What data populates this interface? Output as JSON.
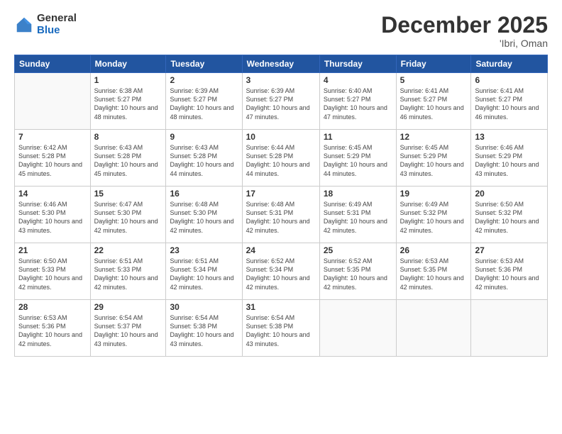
{
  "logo": {
    "general": "General",
    "blue": "Blue"
  },
  "header": {
    "month": "December 2025",
    "location": "'Ibri, Oman"
  },
  "days_of_week": [
    "Sunday",
    "Monday",
    "Tuesday",
    "Wednesday",
    "Thursday",
    "Friday",
    "Saturday"
  ],
  "weeks": [
    [
      {
        "day": "",
        "info": ""
      },
      {
        "day": "1",
        "info": "Sunrise: 6:38 AM\nSunset: 5:27 PM\nDaylight: 10 hours\nand 48 minutes."
      },
      {
        "day": "2",
        "info": "Sunrise: 6:39 AM\nSunset: 5:27 PM\nDaylight: 10 hours\nand 48 minutes."
      },
      {
        "day": "3",
        "info": "Sunrise: 6:39 AM\nSunset: 5:27 PM\nDaylight: 10 hours\nand 47 minutes."
      },
      {
        "day": "4",
        "info": "Sunrise: 6:40 AM\nSunset: 5:27 PM\nDaylight: 10 hours\nand 47 minutes."
      },
      {
        "day": "5",
        "info": "Sunrise: 6:41 AM\nSunset: 5:27 PM\nDaylight: 10 hours\nand 46 minutes."
      },
      {
        "day": "6",
        "info": "Sunrise: 6:41 AM\nSunset: 5:27 PM\nDaylight: 10 hours\nand 46 minutes."
      }
    ],
    [
      {
        "day": "7",
        "info": "Sunrise: 6:42 AM\nSunset: 5:28 PM\nDaylight: 10 hours\nand 45 minutes."
      },
      {
        "day": "8",
        "info": "Sunrise: 6:43 AM\nSunset: 5:28 PM\nDaylight: 10 hours\nand 45 minutes."
      },
      {
        "day": "9",
        "info": "Sunrise: 6:43 AM\nSunset: 5:28 PM\nDaylight: 10 hours\nand 44 minutes."
      },
      {
        "day": "10",
        "info": "Sunrise: 6:44 AM\nSunset: 5:28 PM\nDaylight: 10 hours\nand 44 minutes."
      },
      {
        "day": "11",
        "info": "Sunrise: 6:45 AM\nSunset: 5:29 PM\nDaylight: 10 hours\nand 44 minutes."
      },
      {
        "day": "12",
        "info": "Sunrise: 6:45 AM\nSunset: 5:29 PM\nDaylight: 10 hours\nand 43 minutes."
      },
      {
        "day": "13",
        "info": "Sunrise: 6:46 AM\nSunset: 5:29 PM\nDaylight: 10 hours\nand 43 minutes."
      }
    ],
    [
      {
        "day": "14",
        "info": "Sunrise: 6:46 AM\nSunset: 5:30 PM\nDaylight: 10 hours\nand 43 minutes."
      },
      {
        "day": "15",
        "info": "Sunrise: 6:47 AM\nSunset: 5:30 PM\nDaylight: 10 hours\nand 42 minutes."
      },
      {
        "day": "16",
        "info": "Sunrise: 6:48 AM\nSunset: 5:30 PM\nDaylight: 10 hours\nand 42 minutes."
      },
      {
        "day": "17",
        "info": "Sunrise: 6:48 AM\nSunset: 5:31 PM\nDaylight: 10 hours\nand 42 minutes."
      },
      {
        "day": "18",
        "info": "Sunrise: 6:49 AM\nSunset: 5:31 PM\nDaylight: 10 hours\nand 42 minutes."
      },
      {
        "day": "19",
        "info": "Sunrise: 6:49 AM\nSunset: 5:32 PM\nDaylight: 10 hours\nand 42 minutes."
      },
      {
        "day": "20",
        "info": "Sunrise: 6:50 AM\nSunset: 5:32 PM\nDaylight: 10 hours\nand 42 minutes."
      }
    ],
    [
      {
        "day": "21",
        "info": "Sunrise: 6:50 AM\nSunset: 5:33 PM\nDaylight: 10 hours\nand 42 minutes."
      },
      {
        "day": "22",
        "info": "Sunrise: 6:51 AM\nSunset: 5:33 PM\nDaylight: 10 hours\nand 42 minutes."
      },
      {
        "day": "23",
        "info": "Sunrise: 6:51 AM\nSunset: 5:34 PM\nDaylight: 10 hours\nand 42 minutes."
      },
      {
        "day": "24",
        "info": "Sunrise: 6:52 AM\nSunset: 5:34 PM\nDaylight: 10 hours\nand 42 minutes."
      },
      {
        "day": "25",
        "info": "Sunrise: 6:52 AM\nSunset: 5:35 PM\nDaylight: 10 hours\nand 42 minutes."
      },
      {
        "day": "26",
        "info": "Sunrise: 6:53 AM\nSunset: 5:35 PM\nDaylight: 10 hours\nand 42 minutes."
      },
      {
        "day": "27",
        "info": "Sunrise: 6:53 AM\nSunset: 5:36 PM\nDaylight: 10 hours\nand 42 minutes."
      }
    ],
    [
      {
        "day": "28",
        "info": "Sunrise: 6:53 AM\nSunset: 5:36 PM\nDaylight: 10 hours\nand 42 minutes."
      },
      {
        "day": "29",
        "info": "Sunrise: 6:54 AM\nSunset: 5:37 PM\nDaylight: 10 hours\nand 43 minutes."
      },
      {
        "day": "30",
        "info": "Sunrise: 6:54 AM\nSunset: 5:38 PM\nDaylight: 10 hours\nand 43 minutes."
      },
      {
        "day": "31",
        "info": "Sunrise: 6:54 AM\nSunset: 5:38 PM\nDaylight: 10 hours\nand 43 minutes."
      },
      {
        "day": "",
        "info": ""
      },
      {
        "day": "",
        "info": ""
      },
      {
        "day": "",
        "info": ""
      }
    ]
  ]
}
